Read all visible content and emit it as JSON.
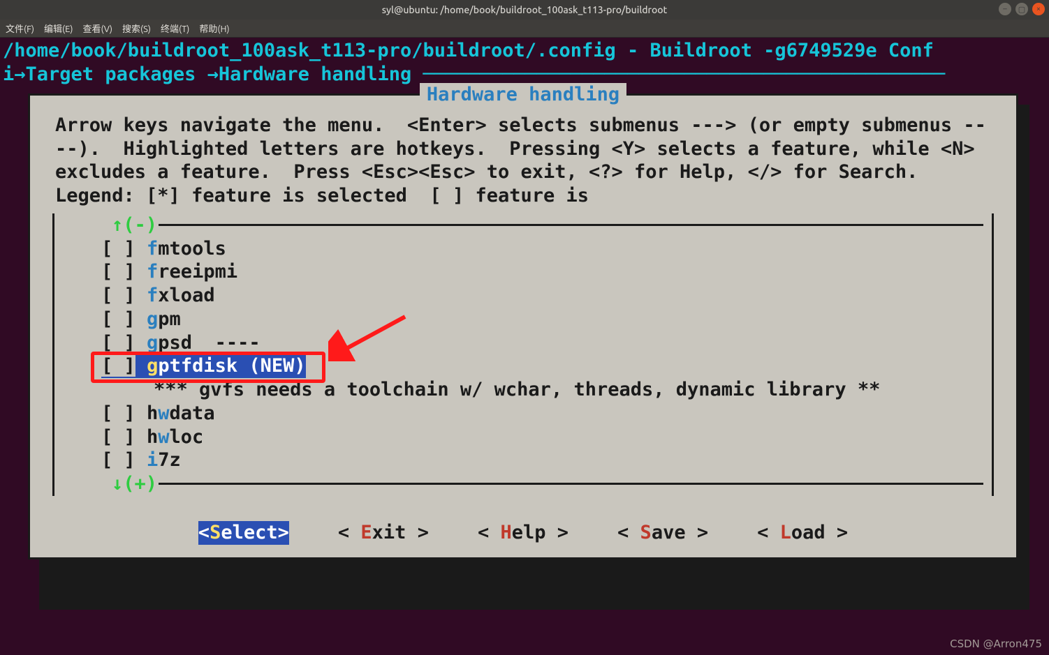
{
  "window": {
    "title": "syl@ubuntu: /home/book/buildroot_100ask_t113-pro/buildroot"
  },
  "menubar": {
    "items": [
      {
        "label": "文件(F)"
      },
      {
        "label": "编辑(E)"
      },
      {
        "label": "查看(V)"
      },
      {
        "label": "搜索(S)"
      },
      {
        "label": "终端(T)"
      },
      {
        "label": "帮助(H)"
      }
    ]
  },
  "config_header": {
    "path": " /home/book/buildroot_100ask_t113-pro/buildroot/.config - Buildroot -g6749529e Conf",
    "breadcrumb_prefix": "i",
    "breadcrumb_a": "Target packages ",
    "breadcrumb_b": "Hardware handling "
  },
  "panel": {
    "title": " Hardware handling ",
    "help_text": "Arrow keys navigate the menu.  <Enter> selects submenus ---> (or empty submenus ----).  Highlighted letters are hotkeys.  Pressing <Y> selects a feature, while <N> excludes a feature.  Press <Esc><Esc> to exit, <?> for Help, </> for Search.  Legend: [*] feature is selected  [ ] feature is",
    "scroll_up": "↑(-)",
    "scroll_down": "↓(+)",
    "options": [
      {
        "checkbox": "[ ]",
        "hot": "f",
        "rest": "mtools",
        "type": "item"
      },
      {
        "checkbox": "[ ]",
        "hot": "f",
        "rest": "reeipmi",
        "type": "item"
      },
      {
        "checkbox": "[ ]",
        "hot": "f",
        "rest": "xload",
        "type": "item"
      },
      {
        "checkbox": "[ ]",
        "hot": "g",
        "rest": "pm",
        "type": "item"
      },
      {
        "checkbox": "[ ]",
        "hot": "g",
        "rest": "psd  ----",
        "type": "item"
      },
      {
        "checkbox": "[ ]",
        "hot": "g",
        "rest": "ptfdisk (NEW)",
        "type": "item",
        "selected": true
      },
      {
        "text": "*** gvfs needs a toolchain w/ wchar, threads, dynamic library **",
        "type": "info"
      },
      {
        "checkbox": "[ ]",
        "hot": "w",
        "pre": "h",
        "rest": "data",
        "type": "item2"
      },
      {
        "checkbox": "[ ]",
        "hot": "w",
        "pre": "h",
        "rest": "loc",
        "type": "item2"
      },
      {
        "checkbox": "[ ]",
        "hot": "i",
        "rest": "7z",
        "type": "item"
      }
    ]
  },
  "buttons": {
    "select": {
      "open": "<",
      "hot": "S",
      "rest": "elect",
      "close": ">"
    },
    "exit": {
      "open": "< ",
      "hot": "E",
      "rest": "xit ",
      "close": ">"
    },
    "help": {
      "open": "< ",
      "hot": "H",
      "rest": "elp ",
      "close": ">"
    },
    "save": {
      "open": "< ",
      "hot": "S",
      "rest": "ave ",
      "close": ">"
    },
    "load": {
      "open": "< ",
      "hot": "L",
      "rest": "oad ",
      "close": ">"
    }
  },
  "watermark": "CSDN @Arron475"
}
